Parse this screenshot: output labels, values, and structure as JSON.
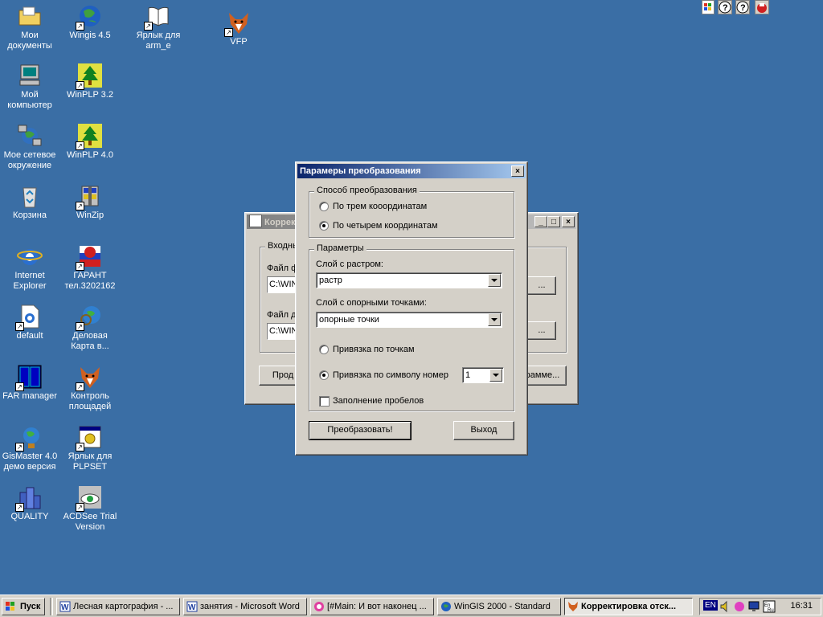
{
  "desktop_icons": [
    {
      "label": "Мои документы",
      "icon": "folder-icon",
      "shortcut": false
    },
    {
      "label": "Wingis 4.5",
      "icon": "globe-icon",
      "shortcut": true
    },
    {
      "label": "Ярлык для arm_e",
      "icon": "book-icon",
      "shortcut": true
    },
    {
      "label": "VFP",
      "icon": "fox-icon",
      "shortcut": true
    },
    {
      "label": "Мой компьютер",
      "icon": "computer-icon",
      "shortcut": false
    },
    {
      "label": "WinPLP 3.2",
      "icon": "tree-map-icon",
      "shortcut": true
    },
    {
      "label": "Мое сетевое окружение",
      "icon": "network-icon",
      "shortcut": false
    },
    {
      "label": "WinPLP 4.0",
      "icon": "tree-map-icon",
      "shortcut": true
    },
    {
      "label": "Корзина",
      "icon": "recycle-bin-icon",
      "shortcut": false
    },
    {
      "label": "WinZip",
      "icon": "winzip-icon",
      "shortcut": true
    },
    {
      "label": "Internet Explorer",
      "icon": "ie-icon",
      "shortcut": false
    },
    {
      "label": "ГАРАНТ тел.3202162",
      "icon": "garant-icon",
      "shortcut": true
    },
    {
      "label": "default",
      "icon": "ie-doc-icon",
      "shortcut": true
    },
    {
      "label": "Деловая Карта в...",
      "icon": "globe-magnifier-icon",
      "shortcut": true
    },
    {
      "label": "FAR manager",
      "icon": "far-icon",
      "shortcut": true
    },
    {
      "label": "Контроль площадей",
      "icon": "fox-icon",
      "shortcut": true
    },
    {
      "label": "GisMaster 4.0 демо версия",
      "icon": "gis-globe-icon",
      "shortcut": true
    },
    {
      "label": "Ярлык для PLPSET",
      "icon": "settings-window-icon",
      "shortcut": true
    },
    {
      "label": "QUALITY",
      "icon": "buildings-icon",
      "shortcut": true
    },
    {
      "label": "ACDSee Trial Version",
      "icon": "eye-icon",
      "shortcut": true
    }
  ],
  "bg_window": {
    "title": "Коррек",
    "group_title": "Входны",
    "file1_label": "Файл ф",
    "file1_value": "C:\\WIN",
    "file2_label": "Файл д",
    "file2_value": "C:\\WIN",
    "browse1": "...",
    "browse2": "...",
    "left_button": "Прод",
    "right_button": "рамме..."
  },
  "dialog": {
    "title": "Парамеры преобразования",
    "method_group": "Способ преобразования",
    "radio_three": "По трем кооординатам",
    "radio_four": "По четырем координатам",
    "params_group": "Параметры",
    "raster_layer_label": "Слой с растром:",
    "raster_layer_value": "растр",
    "points_layer_label": "Слой с опорными точками:",
    "points_layer_value": "опорные точки",
    "radio_points": "Привязка по точкам",
    "radio_symbol": "Привязка по символу номер",
    "symbol_value": "1",
    "fill_gaps": "Заполнение пробелов",
    "convert_button": "Преобразовать!",
    "exit_button": "Выход"
  },
  "taskbar": {
    "start": "Пуск",
    "items": [
      "Лесная картография - ...",
      "занятия - Microsoft Word",
      "[#Main: И вот наконец ...",
      "WinGIS 2000 - Standard",
      "Корректировка отск..."
    ],
    "lang": "EN",
    "clock": "16:31"
  }
}
